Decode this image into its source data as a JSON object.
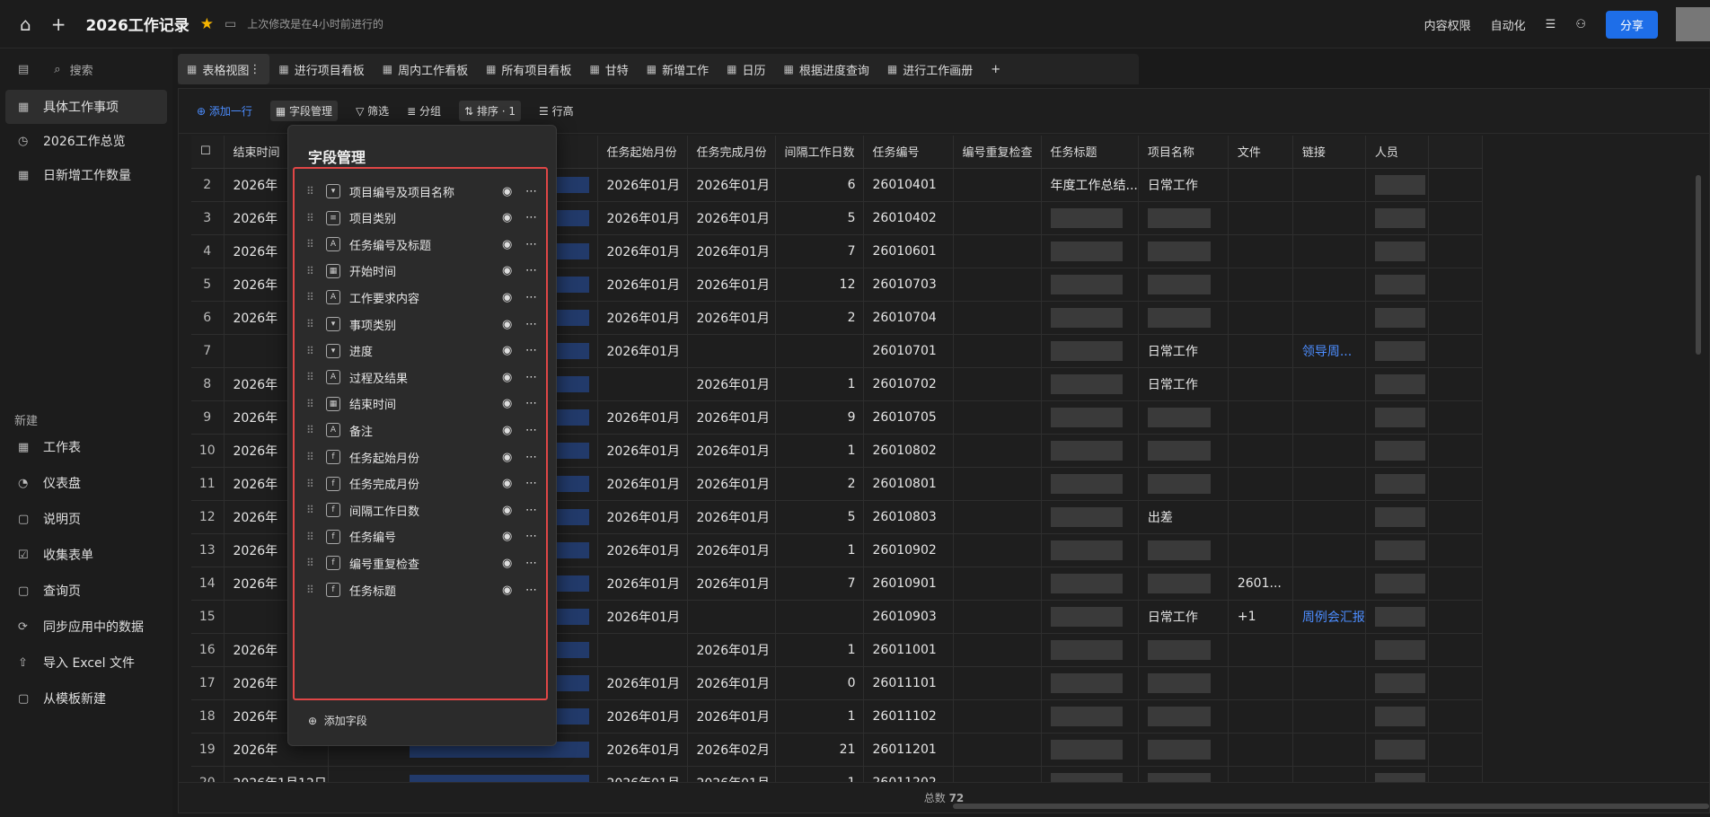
{
  "topbar": {
    "title": "2026工作记录",
    "saved": "上次修改是在4小时前进行的",
    "permission": "内容权限",
    "automation": "自动化",
    "share": "分享"
  },
  "sidebar": {
    "search": "搜索",
    "items": [
      "具体工作事项",
      "2026工作总览",
      "日新增工作数量"
    ],
    "new_label": "新建",
    "new_items": [
      "工作表",
      "仪表盘",
      "说明页",
      "收集表单",
      "查询页",
      "同步应用中的数据",
      "导入 Excel 文件",
      "从模板新建"
    ]
  },
  "tabs": [
    "表格视图",
    "进行项目看板",
    "周内工作看板",
    "所有项目看板",
    "甘特",
    "新增工作",
    "日历",
    "根据进度查询",
    "进行工作画册"
  ],
  "toolbar": {
    "add_row": "添加一行",
    "field_mgmt": "字段管理",
    "filter": "筛选",
    "group": "分组",
    "sort": "排序 · 1",
    "row_height": "行高"
  },
  "columns": [
    "结束时间",
    "任务起始月份",
    "任务完成月份",
    "间隔工作日数",
    "任务编号",
    "编号重复检查",
    "任务标题",
    "项目名称",
    "文件",
    "链接",
    "人员"
  ],
  "rows": [
    {
      "n": "2",
      "end": "2026年",
      "s": "2026年01月",
      "c": "2026年01月",
      "d": "6",
      "id": "26010401",
      "title": "年度工作总结...",
      "proj": "日常工作",
      "file": "",
      "link": ""
    },
    {
      "n": "3",
      "end": "2026年",
      "s": "2026年01月",
      "c": "2026年01月",
      "d": "5",
      "id": "26010402",
      "title": "",
      "proj": "",
      "file": "",
      "link": ""
    },
    {
      "n": "4",
      "end": "2026年",
      "s": "2026年01月",
      "c": "2026年01月",
      "d": "7",
      "id": "26010601",
      "title": "",
      "proj": "",
      "file": "",
      "link": ""
    },
    {
      "n": "5",
      "end": "2026年",
      "s": "2026年01月",
      "c": "2026年01月",
      "d": "12",
      "id": "26010703",
      "title": "",
      "proj": "",
      "file": "",
      "link": ""
    },
    {
      "n": "6",
      "end": "2026年",
      "s": "2026年01月",
      "c": "2026年01月",
      "d": "2",
      "id": "26010704",
      "title": "",
      "proj": "",
      "file": "",
      "link": ""
    },
    {
      "n": "7",
      "end": "",
      "s": "2026年01月",
      "c": "",
      "d": "",
      "id": "26010701",
      "title": "",
      "proj": "日常工作",
      "file": "",
      "link": "领导周..."
    },
    {
      "n": "8",
      "end": "2026年",
      "s": "",
      "c": "2026年01月",
      "d": "1",
      "id": "26010702",
      "title": "",
      "proj": "日常工作",
      "file": "",
      "link": ""
    },
    {
      "n": "9",
      "end": "2026年",
      "s": "2026年01月",
      "c": "2026年01月",
      "d": "9",
      "id": "26010705",
      "title": "",
      "proj": "",
      "file": "",
      "link": ""
    },
    {
      "n": "10",
      "end": "2026年",
      "s": "2026年01月",
      "c": "2026年01月",
      "d": "1",
      "id": "26010802",
      "title": "",
      "proj": "",
      "file": "",
      "link": ""
    },
    {
      "n": "11",
      "end": "2026年",
      "s": "2026年01月",
      "c": "2026年01月",
      "d": "2",
      "id": "26010801",
      "title": "",
      "proj": "",
      "file": "",
      "link": ""
    },
    {
      "n": "12",
      "end": "2026年",
      "s": "2026年01月",
      "c": "2026年01月",
      "d": "5",
      "id": "26010803",
      "title": "",
      "proj": "出差",
      "file": "",
      "link": ""
    },
    {
      "n": "13",
      "end": "2026年",
      "s": "2026年01月",
      "c": "2026年01月",
      "d": "1",
      "id": "26010902",
      "title": "",
      "proj": "",
      "file": "",
      "link": ""
    },
    {
      "n": "14",
      "end": "2026年",
      "s": "2026年01月",
      "c": "2026年01月",
      "d": "7",
      "id": "26010901",
      "title": "",
      "proj": "",
      "file": "2601...",
      "link": ""
    },
    {
      "n": "15",
      "end": "",
      "s": "2026年01月",
      "c": "",
      "d": "",
      "id": "26010903",
      "title": "",
      "proj": "日常工作",
      "file": "+1",
      "link": "周例会汇报"
    },
    {
      "n": "16",
      "end": "2026年",
      "s": "",
      "c": "2026年01月",
      "d": "1",
      "id": "26011001",
      "title": "",
      "proj": "",
      "file": "",
      "link": ""
    },
    {
      "n": "17",
      "end": "2026年",
      "s": "2026年01月",
      "c": "2026年01月",
      "d": "0",
      "id": "26011101",
      "title": "",
      "proj": "",
      "file": "",
      "link": ""
    },
    {
      "n": "18",
      "end": "2026年",
      "s": "2026年01月",
      "c": "2026年01月",
      "d": "1",
      "id": "26011102",
      "title": "",
      "proj": "",
      "file": "",
      "link": ""
    },
    {
      "n": "19",
      "end": "2026年",
      "s": "2026年01月",
      "c": "2026年02月",
      "d": "21",
      "id": "26011201",
      "title": "",
      "proj": "",
      "file": "",
      "link": ""
    },
    {
      "n": "20",
      "end": "2026年1月12日",
      "s": "2026年01月",
      "c": "2026年01月",
      "d": "1",
      "id": "26011202",
      "title": "",
      "proj": "",
      "file": "",
      "link": ""
    }
  ],
  "footer": {
    "label": "总数",
    "count": "72"
  },
  "popup": {
    "title": "字段管理",
    "add": "添加字段",
    "fields": [
      {
        "label": "项目编号及项目名称",
        "icon": "▾"
      },
      {
        "label": "项目类别",
        "icon": "≡"
      },
      {
        "label": "任务编号及标题",
        "icon": "A"
      },
      {
        "label": "开始时间",
        "icon": "▦"
      },
      {
        "label": "工作要求内容",
        "icon": "A"
      },
      {
        "label": "事项类别",
        "icon": "▾"
      },
      {
        "label": "进度",
        "icon": "▾"
      },
      {
        "label": "过程及结果",
        "icon": "A"
      },
      {
        "label": "结束时间",
        "icon": "▦"
      },
      {
        "label": "备注",
        "icon": "A"
      },
      {
        "label": "任务起始月份",
        "icon": "f"
      },
      {
        "label": "任务完成月份",
        "icon": "f"
      },
      {
        "label": "间隔工作日数",
        "icon": "f"
      },
      {
        "label": "任务编号",
        "icon": "f"
      },
      {
        "label": "编号重复检查",
        "icon": "f"
      },
      {
        "label": "任务标题",
        "icon": "f"
      }
    ]
  }
}
